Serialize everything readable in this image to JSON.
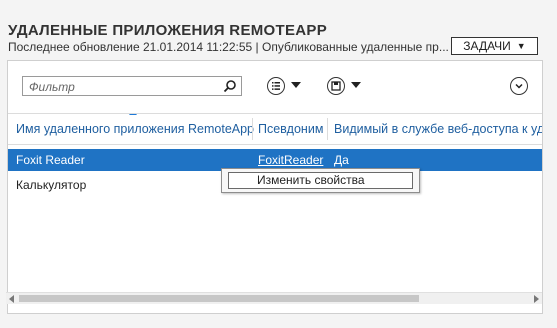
{
  "header": {
    "title": "УДАЛЕННЫЕ ПРИЛОЖЕНИЯ REMOTEAPP",
    "subtitle": "Последнее обновление 21.01.2014 11:22:55 | Опубликованные удаленные пр...",
    "tasks_label": "ЗАДАЧИ"
  },
  "toolbar": {
    "filter_placeholder": "Фильтр"
  },
  "table": {
    "columns": [
      "Имя удаленного приложения RemoteApp",
      "Псевдоним",
      "Видимый в службе веб-доступа к уда"
    ],
    "rows": [
      {
        "name": "Foxit Reader",
        "alias": "FoxitReader",
        "visible": "Да",
        "selected": true
      },
      {
        "name": "Калькулятор",
        "alias": "",
        "visible": "",
        "selected": false
      }
    ]
  },
  "context_menu": {
    "items": [
      {
        "label": "Изменить свойства"
      }
    ]
  }
}
